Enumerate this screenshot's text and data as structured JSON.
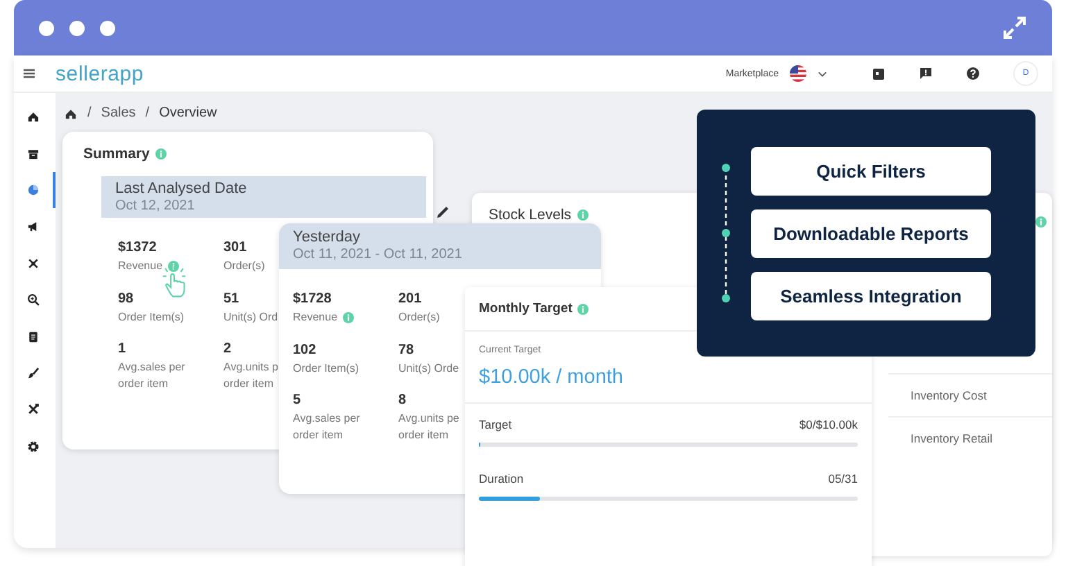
{
  "header": {
    "logo": "sellerapp",
    "marketplace_label": "Marketplace",
    "avatar": "D"
  },
  "sidebar": {
    "items": [
      {
        "selected": false
      },
      {
        "selected": false
      },
      {
        "selected": true
      },
      {
        "selected": false
      },
      {
        "selected": false
      },
      {
        "selected": false
      },
      {
        "selected": false
      },
      {
        "selected": false
      },
      {
        "selected": false
      },
      {
        "selected": false
      }
    ]
  },
  "breadcrumb": [
    {
      "separator": "/",
      "label": "Sales"
    },
    {
      "separator": "/",
      "label": "Overview"
    }
  ],
  "summary": {
    "title": "Summary",
    "period_label": "Last Analysed Date",
    "period_dates": "Oct 12, 2021",
    "metrics": [
      {
        "value": "$1372",
        "label": "Revenue",
        "info": true
      },
      {
        "value": "301",
        "label": "Order(s)"
      },
      {
        "value": "98",
        "label": "Order Item(s)"
      },
      {
        "value": "51",
        "label": "Unit(s) Ord"
      },
      {
        "value": "1",
        "label": "Avg.sales per\norder item"
      },
      {
        "value": "2",
        "label": "Avg.units p\norder item"
      }
    ]
  },
  "yesterday": {
    "period_label": "Yesterday",
    "period_dates": "Oct 11, 2021 - Oct 11, 2021",
    "metrics": [
      {
        "value": "$1728",
        "label": "Revenue",
        "info": true
      },
      {
        "value": "201",
        "label": "Order(s)"
      },
      {
        "value": "102",
        "label": "Order Item(s)"
      },
      {
        "value": "78",
        "label": "Unit(s) Orde"
      },
      {
        "value": "5",
        "label": "Avg.sales per\norder item"
      },
      {
        "value": "8",
        "label": "Avg.units pe\norder item"
      }
    ]
  },
  "stock_levels": {
    "title": "Stock Levels",
    "rows": [
      "Inventory Cost",
      "Inventory Retail"
    ]
  },
  "monthly_target": {
    "title": "Monthly Target",
    "current_label": "Current Target",
    "current_value": "$10.00k / month",
    "progress": [
      {
        "label": "Target",
        "reading": "$0/$10.00k",
        "level": 0
      },
      {
        "label": "Duration",
        "reading": "05/31",
        "level": 0.16
      }
    ]
  },
  "features": [
    "Quick Filters",
    "Downloadable Reports",
    "Seamless Integration"
  ]
}
